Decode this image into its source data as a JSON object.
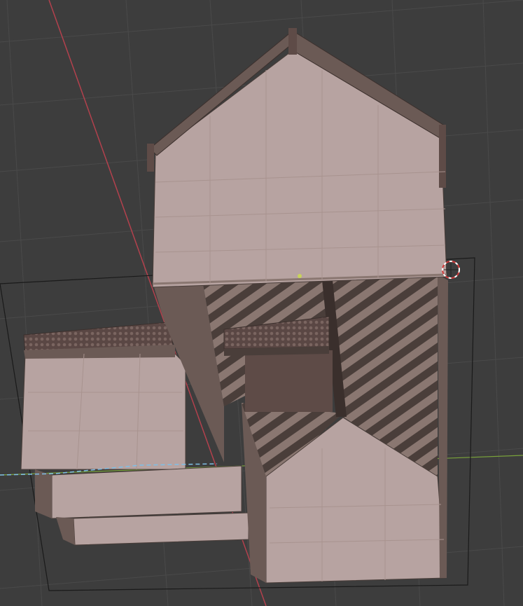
{
  "viewport": {
    "type": "3d-viewport",
    "background_color": "#3d3d3d",
    "grid_color": "#4a4a4a",
    "x_axis_color": "#b3414d",
    "y_axis_color": "#7aa33b",
    "wall_color": "#b7a3a1",
    "wall_shadow_color": "#6b5a55",
    "roof_color": "#5e4b47",
    "icons": [
      "3d-cursor-icon"
    ]
  }
}
